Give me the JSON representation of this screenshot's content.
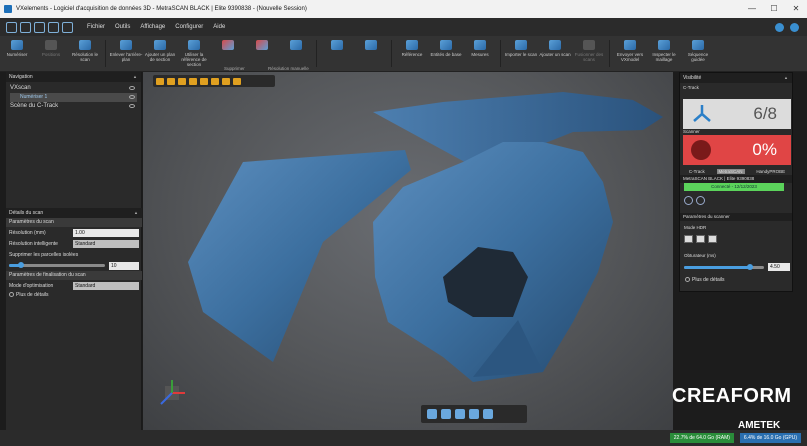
{
  "window": {
    "title": "VXelements - Logiciel d'acquisition de données 3D - MetraSCAN BLACK | Elite 9390838 - (Nouvelle Session)"
  },
  "menu": {
    "items": [
      "Fichier",
      "Outils",
      "Affichage",
      "Configurer",
      "Aide"
    ]
  },
  "ribbon": {
    "buttons": [
      {
        "label": "Numériser",
        "icon": "scan-icon"
      },
      {
        "label": "Positions",
        "icon": "positions-icon",
        "disabled": true
      },
      {
        "label": "Résolution le scan",
        "icon": "resolution-icon"
      },
      {
        "label": "Enlever l'arrière-plan",
        "icon": "remove-background-icon"
      },
      {
        "label": "Ajouter un plan de section",
        "icon": "section-plane-icon"
      },
      {
        "label": "Utiliser la référence de section",
        "icon": "section-reference-icon"
      },
      {
        "label": "",
        "icon": "delete-icon"
      },
      {
        "label": "",
        "icon": "delete-tool-icon"
      },
      {
        "label": "",
        "icon": "delete-tool-2-icon"
      },
      {
        "label": "",
        "icon": "resolution-tool-icon"
      },
      {
        "label": "",
        "icon": "resolution-tool-2-icon"
      },
      {
        "label": "Référence",
        "icon": "reference-icon"
      },
      {
        "label": "Entités de base",
        "icon": "entities-icon"
      },
      {
        "label": "Mesures",
        "icon": "measures-icon"
      },
      {
        "label": "Importer le scan",
        "icon": "import-scan-icon"
      },
      {
        "label": "Ajouter un scan",
        "icon": "add-scan-icon"
      },
      {
        "label": "Fusionner des scans",
        "icon": "merge-icon",
        "disabled": true
      },
      {
        "label": "Envoyer vers VXmodel",
        "icon": "send-vxmodel-icon"
      },
      {
        "label": "Inspecter le maillage",
        "icon": "inspect-mesh-icon"
      },
      {
        "label": "Séquence guidée",
        "icon": "guided-sequence-icon"
      }
    ],
    "groups": {
      "delete": "Supprimer",
      "manual_resolution": "Résolution manuelle"
    }
  },
  "navigation": {
    "title": "Navigation",
    "tree": [
      {
        "label": "VXscan",
        "level": 0
      },
      {
        "label": "Numériser 1",
        "level": 1,
        "selected": true
      },
      {
        "label": "Scène du C-Track",
        "level": 0
      }
    ]
  },
  "scan_details": {
    "title": "Détails du scan",
    "params_title": "Paramètres du scan",
    "resolution_label": "Résolution (mm)",
    "resolution_value": "1.00",
    "smart_resolution_label": "Résolution intelligente",
    "smart_resolution_value": "Standard",
    "isolated_patches_label": "Supprimer les parcelles isolées",
    "isolated_patches_value": "10",
    "isolated_patches_level": 0.12,
    "finalization_title": "Paramètres de finalisation du scan",
    "optimization_label": "Mode d'optimisation",
    "optimization_value": "Standard",
    "more_details": "Plus de détails"
  },
  "visibility": {
    "title": "Visibilité",
    "ctrack_label": "C-Track",
    "ctrack_value": "6/8",
    "scanner_label": "Scanner",
    "scanner_value": "0%",
    "toggles": [
      "C-Track",
      "MetraSCAN",
      "HandyPROBE"
    ],
    "device_title": "MetraSCAN BLACK | Elite 9390838",
    "status": "Connecté - 12/12/2023",
    "scanner_params_title": "Paramètres du scanner",
    "hdr_label": "Mode HDR",
    "shutter_label": "Obturateur (ms)",
    "shutter_value": "4.50",
    "shutter_level": 0.82,
    "more_details": "Plus de détails"
  },
  "status": {
    "ram": "22.7% de 64.0 Go (RAM)",
    "gpu": "6.4% de 16.0 Go (GPU)"
  },
  "branding": {
    "creaform": "CREAFORM",
    "ametek": "AMETEK"
  }
}
